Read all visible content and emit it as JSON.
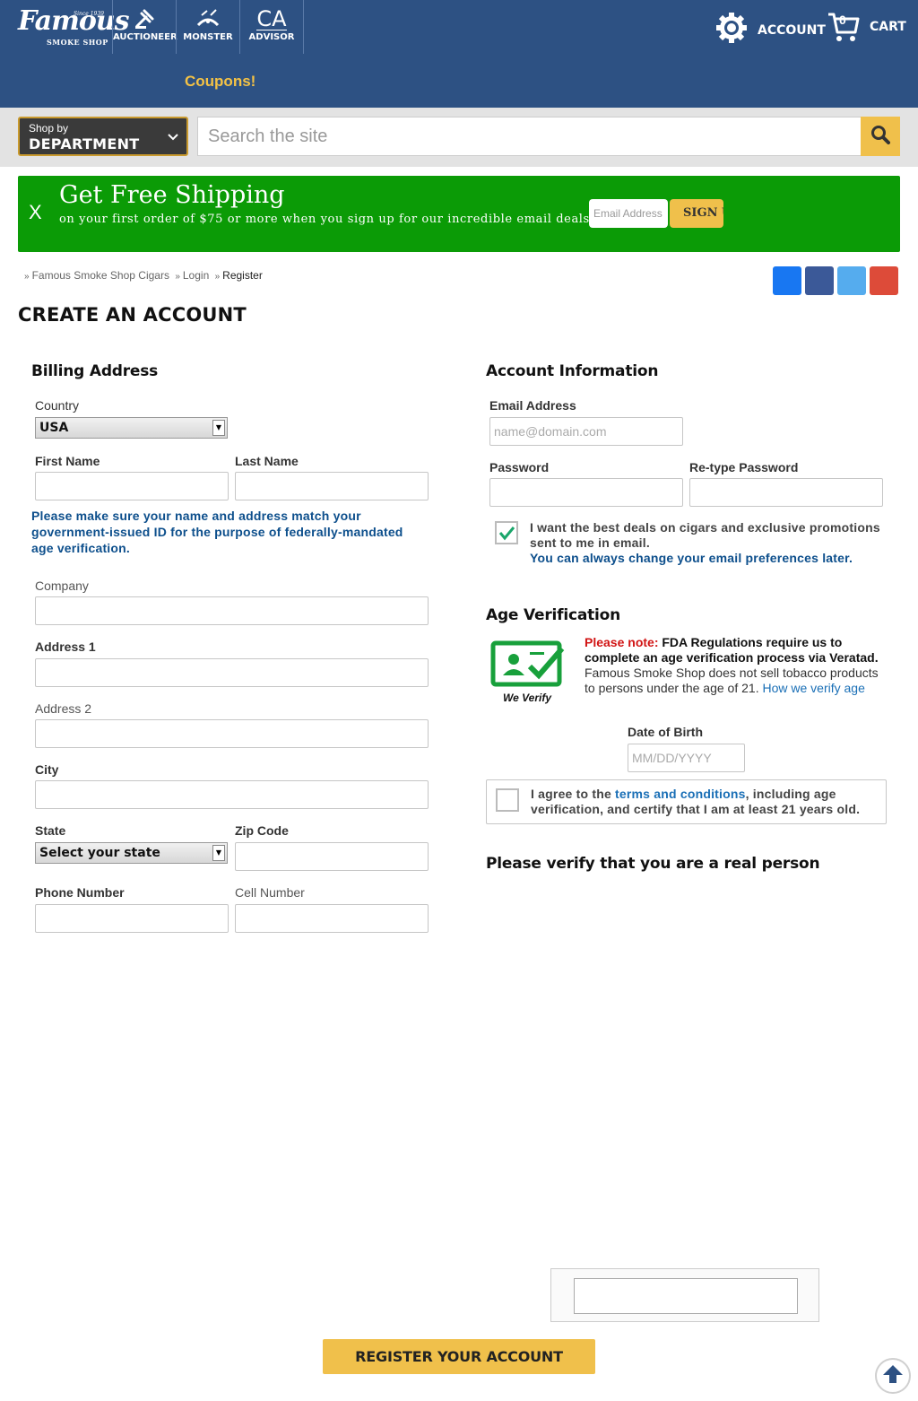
{
  "header": {
    "logo": {
      "name": "Famous",
      "since": "Since 1939",
      "sub": "SMOKE SHOP"
    },
    "brands": [
      {
        "label": "AUCTIONEER",
        "icon": "auctioneer-icon"
      },
      {
        "label": "MONSTER",
        "icon": "monster-icon"
      },
      {
        "label": "ADVISOR",
        "icon_text": "CA",
        "icon": "advisor-icon"
      }
    ],
    "coupons": "Coupons!",
    "account_label": "ACCOUNT",
    "cart_label": "CART",
    "cart_count": "0"
  },
  "search": {
    "dept_small": "Shop by",
    "dept_big": "DEPARTMENT",
    "placeholder": "Search the site"
  },
  "promo": {
    "close": "X",
    "headline": "Get Free Shipping",
    "subline": "on your first order of $75 or more when you sign up for our incredible email deals.",
    "email_placeholder": "Email Address",
    "sign_label": "SIGN UP"
  },
  "breadcrumb": {
    "items": [
      "Famous Smoke Shop Cigars",
      "Login"
    ],
    "current": "Register"
  },
  "social_colors": [
    "#1877f2",
    "#3b5998",
    "#55acee",
    "#dd4b39"
  ],
  "page_title": "CREATE AN ACCOUNT",
  "billing": {
    "title": "Billing Address",
    "country_label": "Country",
    "country_value": "USA",
    "first_name_label": "First Name",
    "last_name_label": "Last Name",
    "id_note": "Please make sure your name and address match your government-issued ID for the purpose of federally-mandated age verification.",
    "company_label": "Company",
    "address1_label": "Address 1",
    "address2_label": "Address 2",
    "city_label": "City",
    "state_label": "State",
    "state_value": "Select your state",
    "zip_label": "Zip Code",
    "phone_label": "Phone Number",
    "cell_label": "Cell Number"
  },
  "account": {
    "title": "Account Information",
    "email_label": "Email Address",
    "email_placeholder": "name@domain.com",
    "password_label": "Password",
    "retype_label": "Re-type Password",
    "optin_text": "I want the best deals on cigars and exclusive promotions sent to me in email.",
    "optin_note": "You can always change your email preferences later.",
    "optin_checked": true
  },
  "age": {
    "title": "Age Verification",
    "badge_label": "We Verify",
    "note_label": "Please note:",
    "note_bold": "FDA Regulations require us to complete an age verification process via Veratad.",
    "note_text": "Famous Smoke Shop does not sell tobacco products to persons under the age of 21.",
    "note_link": "How we verify age",
    "dob_label": "Date of Birth",
    "dob_placeholder": "MM/DD/YYYY",
    "agree_prefix": "I agree to the ",
    "agree_link": "terms and conditions",
    "agree_suffix": ", including age verification, and certify that I am at least 21 years old."
  },
  "captcha_title": "Please verify that you are a real person",
  "register_label": "REGISTER YOUR ACCOUNT",
  "colors": {
    "header": "#2d5183",
    "promo": "#0b9b06",
    "accent": "#f0c04b",
    "link": "#1a6fb6"
  }
}
